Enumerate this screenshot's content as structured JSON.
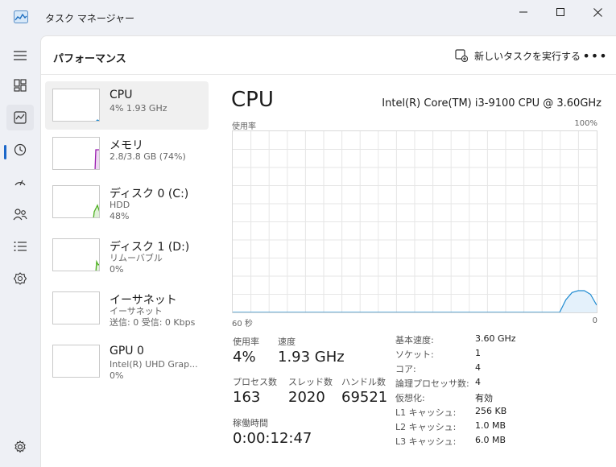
{
  "window": {
    "title": "タスク マネージャー"
  },
  "header": {
    "page_title": "パフォーマンス",
    "run_task_label": "新しいタスクを実行する",
    "more_label": "•••"
  },
  "nav": {
    "items": [
      {
        "id": "menu",
        "icon": "hamburger-icon"
      },
      {
        "id": "processes",
        "icon": "processes-icon"
      },
      {
        "id": "performance",
        "icon": "performance-icon",
        "active": true
      },
      {
        "id": "app-history",
        "icon": "history-icon"
      },
      {
        "id": "startup",
        "icon": "startup-icon"
      },
      {
        "id": "users",
        "icon": "users-icon"
      },
      {
        "id": "details",
        "icon": "details-icon"
      },
      {
        "id": "services",
        "icon": "services-icon"
      },
      {
        "id": "settings",
        "icon": "settings-icon"
      }
    ]
  },
  "resources": [
    {
      "name": "CPU",
      "sub1": "4%  1.93 GHz",
      "sub2": "",
      "sub3": "",
      "color": "#1f8bd1",
      "selected": true
    },
    {
      "name": "メモリ",
      "sub1": "2.8/3.8 GB (74%)",
      "sub2": "",
      "sub3": "",
      "color": "#9b1fb0"
    },
    {
      "name": "ディスク 0 (C:)",
      "sub1": "HDD",
      "sub2": "48%",
      "sub3": "",
      "color": "#4caf1f"
    },
    {
      "name": "ディスク 1 (D:)",
      "sub1": "リムーバブル",
      "sub2": "0%",
      "sub3": "",
      "color": "#4caf1f"
    },
    {
      "name": "イーサネット",
      "sub1": "イーサネット",
      "sub2": "送信: 0 受信: 0 Kbps",
      "sub3": "",
      "color": "#b07a1f"
    },
    {
      "name": "GPU 0",
      "sub1": "Intel(R) UHD Grap...",
      "sub2": "0%",
      "sub3": "",
      "color": "#1f8bd1"
    }
  ],
  "detail": {
    "title": "CPU",
    "model": "Intel(R) Core(TM) i3-9100 CPU @ 3.60GHz",
    "graph_label": "使用率",
    "graph_max": "100%",
    "graph_left_time": "60 秒",
    "graph_right_time": "0",
    "graph_color": "#1f8bd1",
    "graph_fill": "#e4f1fb",
    "usage_label": "使用率",
    "usage_value": "4%",
    "speed_label": "速度",
    "speed_value": "1.93 GHz",
    "processes_label": "プロセス数",
    "processes_value": "163",
    "threads_label": "スレッド数",
    "threads_value": "2020",
    "handles_label": "ハンドル数",
    "handles_value": "69521",
    "uptime_label": "稼働時間",
    "uptime_value": "0:00:12:47",
    "specs": [
      {
        "label": "基本速度:",
        "value": "3.60 GHz"
      },
      {
        "label": "ソケット:",
        "value": "1"
      },
      {
        "label": "コア:",
        "value": "4"
      },
      {
        "label": "論理プロセッサ数:",
        "value": "4"
      },
      {
        "label": "仮想化:",
        "value": "有効"
      },
      {
        "label": "L1 キャッシュ:",
        "value": "256 KB"
      },
      {
        "label": "L2 キャッシュ:",
        "value": "1.0 MB"
      },
      {
        "label": "L3 キャッシュ:",
        "value": "6.0 MB"
      }
    ],
    "usage_history": [
      0,
      0,
      0,
      0,
      0,
      0,
      0,
      0,
      0,
      0,
      0,
      0,
      0,
      0,
      0,
      0,
      0,
      0,
      0,
      0,
      0,
      0,
      0,
      0,
      0,
      0,
      0,
      0,
      0,
      0,
      0,
      0,
      0,
      0,
      0,
      0,
      0,
      0,
      0,
      0,
      0,
      0,
      0,
      0,
      0,
      0,
      0,
      0,
      0,
      0,
      0,
      0,
      0,
      0,
      7,
      11,
      12,
      12,
      10,
      4
    ]
  }
}
